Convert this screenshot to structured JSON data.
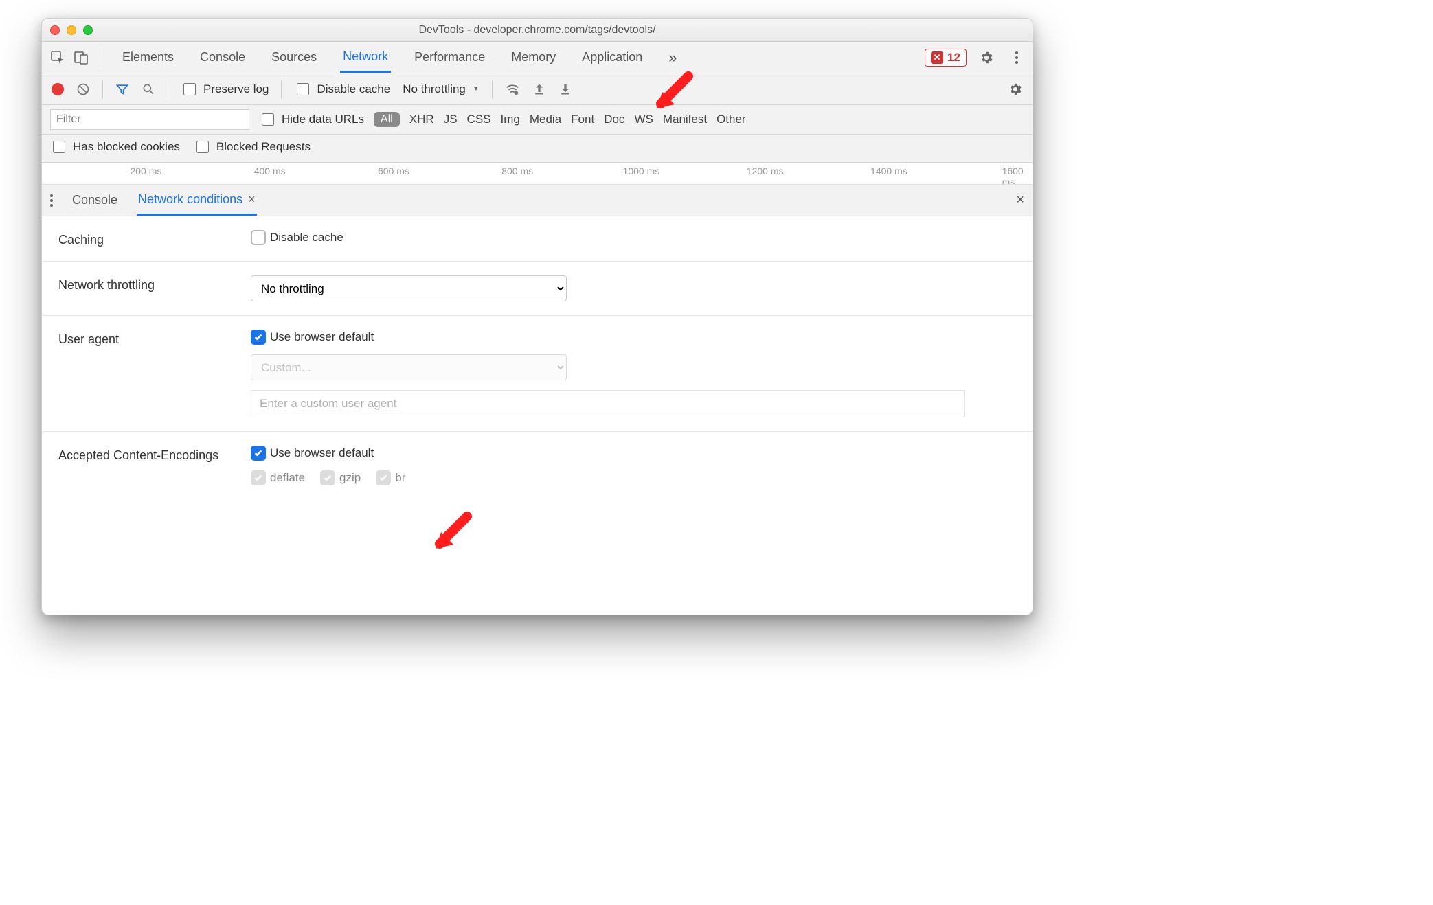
{
  "window": {
    "title": "DevTools - developer.chrome.com/tags/devtools/"
  },
  "topTabs": {
    "items": [
      "Elements",
      "Console",
      "Sources",
      "Network",
      "Performance",
      "Memory",
      "Application"
    ],
    "active": "Network",
    "overflow": "»",
    "error_count": "12"
  },
  "toolbar": {
    "preserve_log": "Preserve log",
    "disable_cache": "Disable cache",
    "throttling": "No throttling"
  },
  "filter": {
    "placeholder": "Filter",
    "hide_data_urls": "Hide data URLs",
    "types": [
      "All",
      "XHR",
      "JS",
      "CSS",
      "Img",
      "Media",
      "Font",
      "Doc",
      "WS",
      "Manifest",
      "Other"
    ],
    "has_blocked_cookies": "Has blocked cookies",
    "blocked_requests": "Blocked Requests"
  },
  "timeline": {
    "ticks": [
      "200 ms",
      "400 ms",
      "600 ms",
      "800 ms",
      "1000 ms",
      "1200 ms",
      "1400 ms",
      "1600 ms"
    ]
  },
  "drawer": {
    "tabs": [
      "Console",
      "Network conditions"
    ],
    "active": "Network conditions"
  },
  "nc": {
    "caching_label": "Caching",
    "caching_disable": "Disable cache",
    "throttling_label": "Network throttling",
    "throttling_value": "No throttling",
    "ua_label": "User agent",
    "ua_default": "Use browser default",
    "ua_custom_placeholder_select": "Custom...",
    "ua_custom_placeholder_input": "Enter a custom user agent",
    "enc_label": "Accepted Content-Encodings",
    "enc_default": "Use browser default",
    "enc_opts": [
      "deflate",
      "gzip",
      "br"
    ]
  }
}
